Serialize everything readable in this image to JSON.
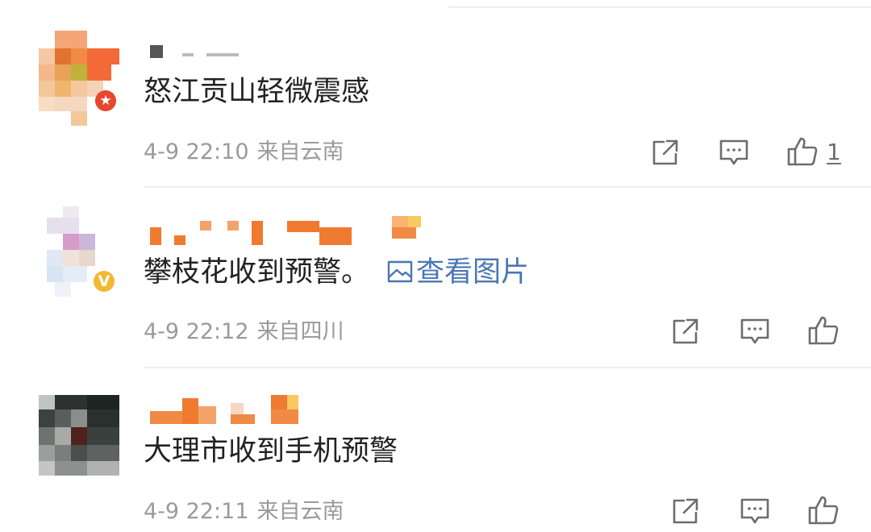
{
  "comments": [
    {
      "text": "怒江贡山轻微震感",
      "date": "4-9 22:10",
      "location": "来自云南",
      "like_count": "1",
      "badge": "red-star",
      "colors": {
        "badge": "#e8472f"
      }
    },
    {
      "text": "攀枝花收到预警。",
      "view_image_label": "查看图片",
      "date": "4-9 22:12",
      "location": "来自四川",
      "badge": "verified-v",
      "colors": {
        "badge": "#f2b830",
        "link": "#4a77b4"
      }
    },
    {
      "text": "大理市收到手机预警",
      "date": "4-9 22:11",
      "location": "来自云南"
    }
  ],
  "icons": {
    "share": "share-icon",
    "comment": "comment-icon",
    "like": "thumbs-up-icon",
    "picture": "picture-icon"
  },
  "colors": {
    "text": "#222222",
    "meta": "#9a9a9a",
    "action_icon": "#6d6d6d",
    "separator": "#eeeeee"
  }
}
